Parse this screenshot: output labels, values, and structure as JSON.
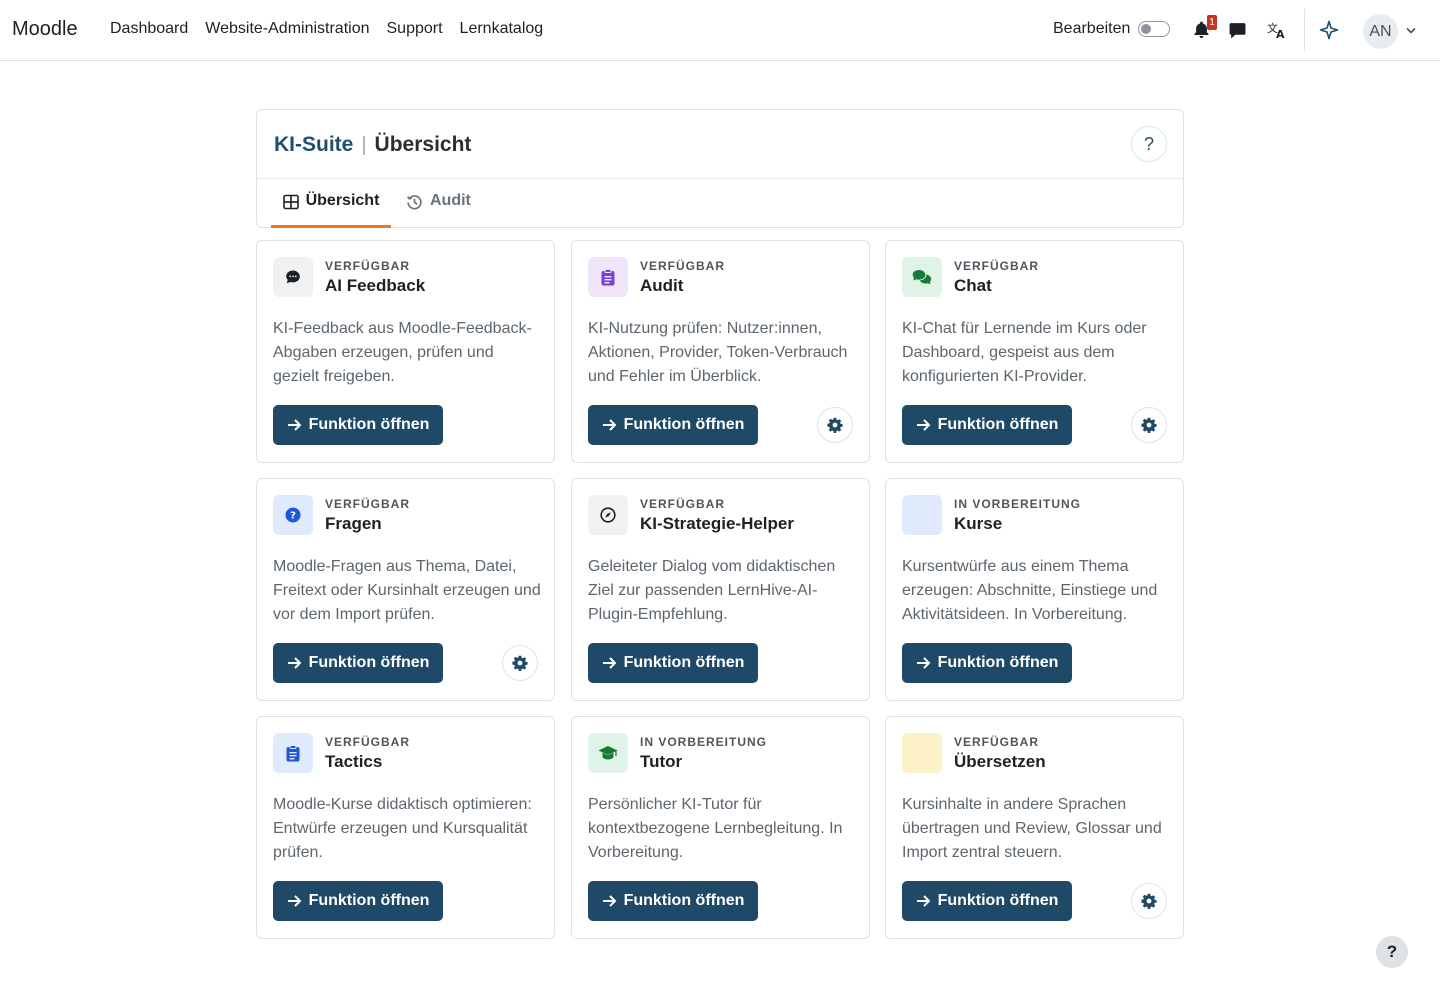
{
  "navbar": {
    "brand": "Moodle",
    "items": [
      "Dashboard",
      "Website-Administration",
      "Support",
      "Lernkatalog"
    ],
    "edit_mode_label": "Bearbeiten",
    "edit_mode_on": false,
    "notification_count": "1",
    "avatar_initials": "AN"
  },
  "header": {
    "suite": "KI-Suite",
    "separator": "|",
    "page": "Übersicht",
    "help": "?",
    "tabs": [
      {
        "label": "Übersicht",
        "icon": "grid-icon",
        "active": true
      },
      {
        "label": "Audit",
        "icon": "history-icon",
        "active": false
      }
    ]
  },
  "button_label": "Funktion öffnen",
  "cards": [
    {
      "status": "VERFÜGBAR",
      "title": "AI Feedback",
      "desc": "KI-Feedback aus Moodle-Feedback-Abgaben erzeugen, prüfen und gezielt freigeben.",
      "icon": "comment-dots-icon",
      "icon_bg": "#f0f1f3",
      "icon_color": "#1d2125",
      "settings": false
    },
    {
      "status": "VERFÜGBAR",
      "title": "Audit",
      "desc": "KI-Nutzung prüfen: Nutzer:innen, Aktionen, Provider, Token-Verbrauch und Fehler im Überblick.",
      "icon": "clipboard-list-icon",
      "icon_bg": "#efe6fb",
      "icon_color": "#7a3fd6",
      "settings": true
    },
    {
      "status": "VERFÜGBAR",
      "title": "Chat",
      "desc": "KI-Chat für Lernende im Kurs oder Dashboard, gespeist aus dem konfigurierten KI-Provider.",
      "icon": "comments-icon",
      "icon_bg": "#dff3e6",
      "icon_color": "#17793a",
      "settings": true
    },
    {
      "status": "VERFÜGBAR",
      "title": "Fragen",
      "desc": "Moodle-Fragen aus Thema, Datei, Freitext oder Kursinhalt erzeugen und vor dem Import prüfen.",
      "icon": "question-circle-icon",
      "icon_bg": "#dfeafc",
      "icon_color": "#1f57d6",
      "settings": true
    },
    {
      "status": "VERFÜGBAR",
      "title": "KI-Strategie-Helper",
      "desc": "Geleiteter Dialog vom didaktischen Ziel zur passenden LernHive-AI-Plugin-Empfehlung.",
      "icon": "compass-icon",
      "icon_bg": "#f0f1f3",
      "icon_color": "#1d2125",
      "settings": false
    },
    {
      "status": "IN VORBEREITUNG",
      "title": "Kurse",
      "desc": "Kursentwürfe aus einem Thema erzeugen: Abschnitte, Einstiege und Aktivitätsideen. In Vorbereitung.",
      "icon": "blank-icon",
      "icon_bg": "#dfeafc",
      "icon_color": "#1f57d6",
      "settings": false
    },
    {
      "status": "VERFÜGBAR",
      "title": "Tactics",
      "desc": "Moodle-Kurse didaktisch optimieren: Entwürfe erzeugen und Kursqualität prüfen.",
      "icon": "clipboard-list-icon",
      "icon_bg": "#dfeafc",
      "icon_color": "#1f57d6",
      "settings": false
    },
    {
      "status": "IN VORBEREITUNG",
      "title": "Tutor",
      "desc": "Persönlicher KI-Tutor für kontextbezogene Lernbegleitung. In Vorbereitung.",
      "icon": "graduation-cap-icon",
      "icon_bg": "#dff3e6",
      "icon_color": "#17793a",
      "settings": false
    },
    {
      "status": "VERFÜGBAR",
      "title": "Übersetzen",
      "desc": "Kursinhalte in andere Sprachen übertragen und Review, Glossar und Import zentral steuern.",
      "icon": "blank-icon",
      "icon_bg": "#fdf1c8",
      "icon_color": "#b8860b",
      "settings": true
    }
  ],
  "footer_help": "?"
}
